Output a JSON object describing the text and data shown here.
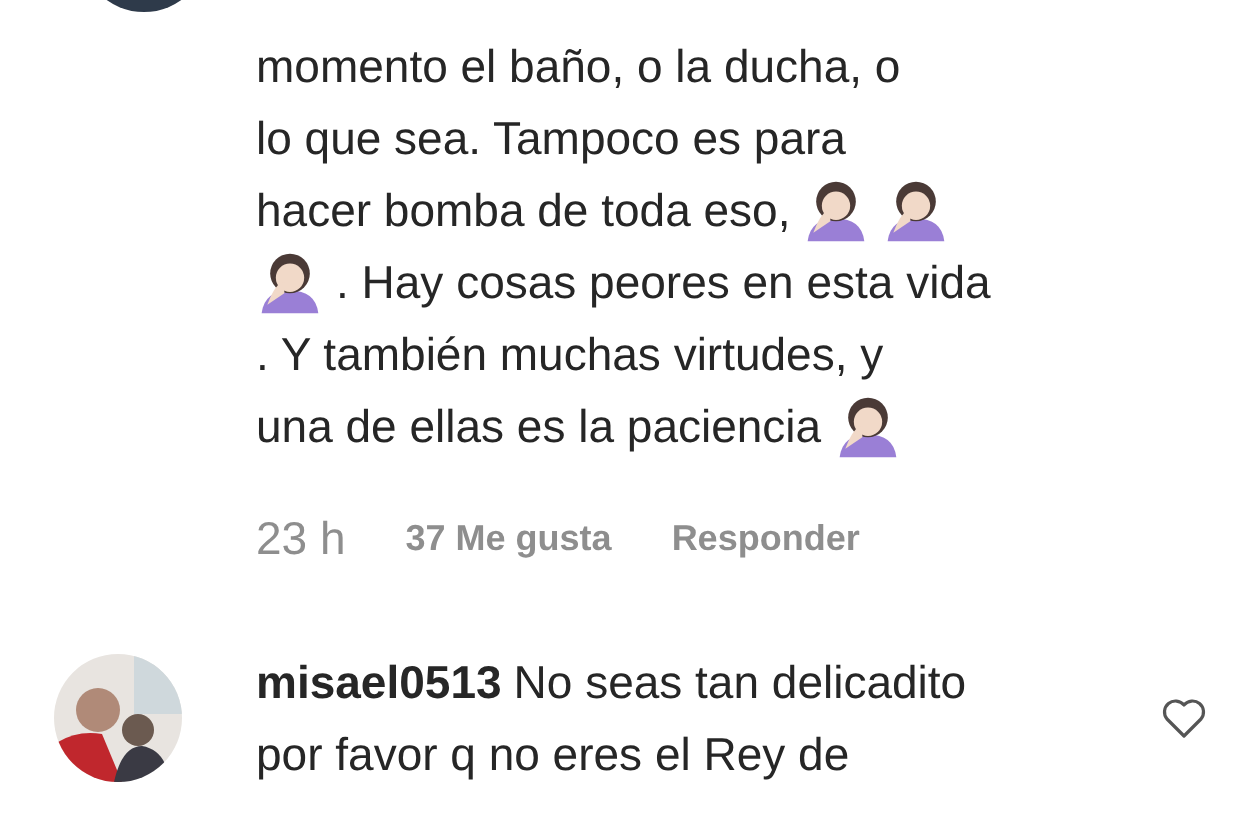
{
  "comments": [
    {
      "lines": [
        {
          "parts": [
            {
              "kind": "text",
              "text": "momento el baño, o la ducha, o"
            }
          ]
        },
        {
          "parts": [
            {
              "kind": "text",
              "text": "lo que sea. Tampoco es para"
            }
          ]
        },
        {
          "parts": [
            {
              "kind": "text",
              "text": "hacer bomba de toda eso,"
            },
            {
              "kind": "emoji"
            },
            {
              "kind": "emoji"
            }
          ]
        },
        {
          "parts": [
            {
              "kind": "emoji"
            },
            {
              "kind": "text",
              "text": ". Hay cosas peores en esta vida"
            }
          ]
        },
        {
          "parts": [
            {
              "kind": "text",
              "text": ". Y también muchas virtudes, y"
            }
          ]
        },
        {
          "parts": [
            {
              "kind": "text",
              "text": "una de ellas es la paciencia"
            },
            {
              "kind": "emoji"
            }
          ]
        }
      ],
      "time": "23 h",
      "likes": "37 Me gusta",
      "reply": "Responder"
    },
    {
      "username": "misael0513",
      "lines": [
        {
          "parts": [
            {
              "kind": "text",
              "text": "No seas tan delicadito"
            }
          ]
        },
        {
          "parts": [
            {
              "kind": "text",
              "text": "por favor q no eres el Rey de"
            }
          ]
        }
      ],
      "liked": false
    }
  ]
}
